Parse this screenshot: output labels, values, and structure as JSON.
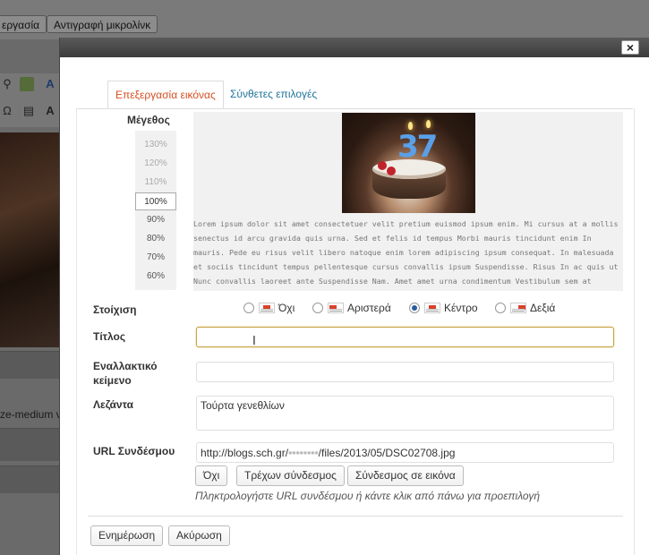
{
  "background": {
    "buttons": [
      "εργασία",
      "Αντιγραφή μικρολίνκ"
    ],
    "partial_text": "ze-medium v"
  },
  "dialog": {
    "close_symbol": "×",
    "tabs": [
      "Επεξεργασία εικόνας",
      "Σύνθετες επιλογές"
    ],
    "active_tab_index": 0,
    "size": {
      "label": "Μέγεθος",
      "options": [
        "130%",
        "120%",
        "110%",
        "100%",
        "90%",
        "80%",
        "70%",
        "60%"
      ],
      "selected": "100%"
    },
    "preview_text": "Lorem ipsum dolor sit amet consectetuer velit pretium euismod ipsum enim. Mi cursus at a mollis senectus id arcu gravida quis urna. Sed et felis id tempus Morbi mauris tincidunt enim In mauris. Pede eu risus velit libero natoque enim lorem adipiscing ipsum consequat. In malesuada et sociis tincidunt tempus pellentesque cursus convallis ipsum Suspendisse. Risus In ac quis ut Nunc convallis laoreet ante Suspendisse Nam. Amet amet urna condimentum Vestibulum sem at",
    "preview_image_text": "37",
    "alignment": {
      "label": "Στοίχιση",
      "options": [
        "Όχι",
        "Αριστερά",
        "Κέντρο",
        "Δεξιά"
      ],
      "selected": "Κέντρο"
    },
    "title_field": {
      "label": "Τίτλος",
      "value": ""
    },
    "alt_field": {
      "label": "Εναλλακτικό κείμενο",
      "value": ""
    },
    "caption_field": {
      "label": "Λεζάντα",
      "value": "Τούρτα γενεθλίων"
    },
    "url_field": {
      "label": "URL Συνδέσμου",
      "value_prefix": "http://blogs.sch.gr/",
      "value_blurred": "••••••••",
      "value_suffix": "/files/2013/05/DSC02708.jpg"
    },
    "link_buttons": [
      "Όχι",
      "Τρέχων σύνδεσμος",
      "Σύνδεσμος σε εικόνα"
    ],
    "link_hint": "Πληκτρολογήστε URL συνδέσμου ή κάντε κλικ από πάνω για προεπιλογή",
    "action_buttons": {
      "update": "Ενημέρωση",
      "cancel": "Ακύρωση"
    }
  },
  "colors": {
    "active_tab": "#d54e21",
    "inactive_tab": "#21759b",
    "focus_border": "#c8a243",
    "overlay": "#6a6a6a"
  }
}
